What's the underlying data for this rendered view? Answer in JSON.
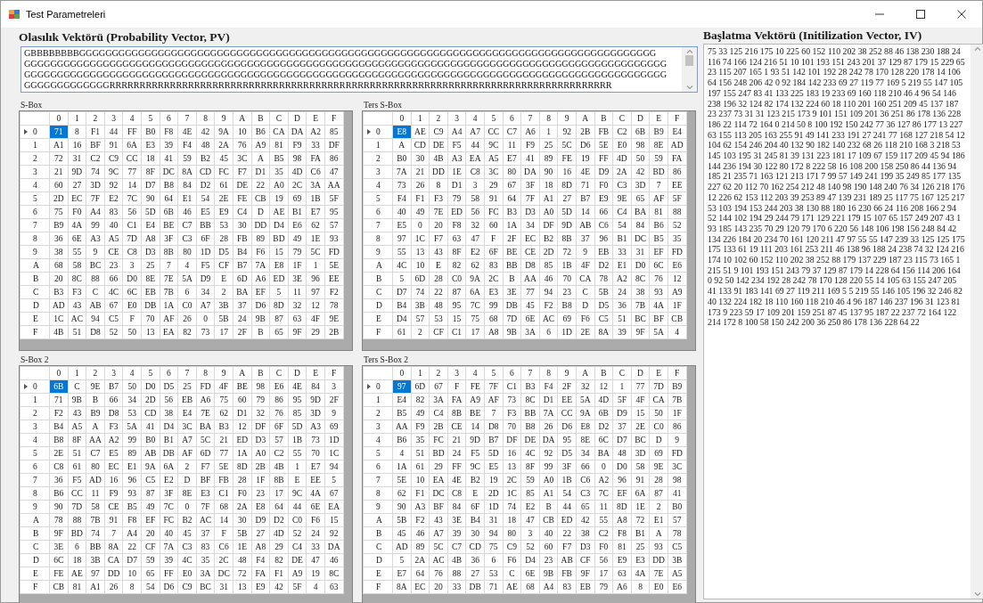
{
  "window": {
    "title": "Test Parametreleri"
  },
  "probability_vector": {
    "title": "Olasılık Vektörü (Probability Vector, PV)",
    "lines": [
      "GBBBBBBBBGGGGGGGGGGGGGGGGGGGGGGGGGGGGGGGGGGGGGGGGGGGGGGGGGGGGGGGGGGGGGGGGGGGGGGGGGGGGGGGGGGGGGGGG",
      "GGGGGGGGGGGGGGGGGGGGGGGGGGGGGGGGGGGGGGGGGGGGGGGGGGGGGGGGGGGGGGGGGGGGGGGGGGGGGGGGGGGGGGGGGGGGGGGGGG",
      "GGGGGGGGGGGGGGGGGGGGGGGGGGGGGGGGGGGGGGGGGGGGGGGGGGGGGGGGGGGGGGGGGGGGGGGGGGGGGGGGGGGGGGGGGGGGGGGGGG",
      "GGGGGGGGGGGGGRRRRRRRRRRRRRRRRRRRRRRRRRRRRRRRRRRRRRRRRRRRRRRRRRRRRRRRRRRRRRRRRRRRRRRRRRRRRRRRRRRR"
    ]
  },
  "tables": [
    {
      "title": "S-Box",
      "columns": [
        "0",
        "1",
        "2",
        "3",
        "4",
        "5",
        "6",
        "7",
        "8",
        "9",
        "A",
        "B",
        "C",
        "D",
        "E",
        "F"
      ],
      "rows": [
        {
          "header": "0",
          "selected": true,
          "cells": [
            "71",
            "8",
            "F1",
            "44",
            "FF",
            "B0",
            "F8",
            "4E",
            "42",
            "9A",
            "10",
            "B6",
            "CA",
            "DA",
            "A2",
            "85"
          ]
        },
        {
          "header": "1",
          "selected": false,
          "cells": [
            "A1",
            "16",
            "BF",
            "91",
            "6A",
            "E3",
            "39",
            "F4",
            "48",
            "2A",
            "76",
            "A9",
            "81",
            "F9",
            "33",
            "DF"
          ]
        },
        {
          "header": "2",
          "selected": false,
          "cells": [
            "72",
            "31",
            "C2",
            "C9",
            "CC",
            "18",
            "41",
            "59",
            "B2",
            "45",
            "3C",
            "A",
            "B5",
            "98",
            "FA",
            "86"
          ]
        },
        {
          "header": "3",
          "selected": false,
          "cells": [
            "21",
            "9D",
            "74",
            "9C",
            "77",
            "8F",
            "DC",
            "8A",
            "CD",
            "FC",
            "F7",
            "D1",
            "35",
            "4D",
            "C6",
            "47"
          ]
        },
        {
          "header": "4",
          "selected": false,
          "cells": [
            "60",
            "27",
            "3D",
            "92",
            "14",
            "D7",
            "B8",
            "84",
            "D2",
            "61",
            "DE",
            "22",
            "A0",
            "2C",
            "3A",
            "AA"
          ]
        },
        {
          "header": "5",
          "selected": false,
          "cells": [
            "2D",
            "EC",
            "7F",
            "E2",
            "7C",
            "90",
            "64",
            "E1",
            "54",
            "2E",
            "FE",
            "CB",
            "19",
            "69",
            "1B",
            "5F"
          ]
        },
        {
          "header": "6",
          "selected": false,
          "cells": [
            "75",
            "F0",
            "A4",
            "83",
            "56",
            "5D",
            "6B",
            "46",
            "E5",
            "E9",
            "C4",
            "D",
            "AE",
            "B1",
            "E7",
            "95"
          ]
        },
        {
          "header": "7",
          "selected": false,
          "cells": [
            "B9",
            "4A",
            "99",
            "40",
            "C1",
            "E4",
            "BE",
            "C7",
            "BB",
            "53",
            "30",
            "DD",
            "D4",
            "E6",
            "62",
            "57"
          ]
        },
        {
          "header": "8",
          "selected": false,
          "cells": [
            "36",
            "6E",
            "A3",
            "A5",
            "7D",
            "A8",
            "3F",
            "C3",
            "6F",
            "28",
            "FB",
            "89",
            "BD",
            "49",
            "1E",
            "93"
          ]
        },
        {
          "header": "9",
          "selected": false,
          "cells": [
            "38",
            "55",
            "9",
            "CE",
            "C8",
            "D3",
            "8B",
            "80",
            "1D",
            "D5",
            "B4",
            "F6",
            "15",
            "79",
            "5C",
            "FD"
          ]
        },
        {
          "header": "A",
          "selected": false,
          "cells": [
            "68",
            "58",
            "BC",
            "23",
            "3",
            "25",
            "7",
            "4",
            "F5",
            "CF",
            "B7",
            "7A",
            "E8",
            "1F",
            "1",
            "5E"
          ]
        },
        {
          "header": "B",
          "selected": false,
          "cells": [
            "20",
            "8C",
            "88",
            "66",
            "D0",
            "8E",
            "7E",
            "5A",
            "D9",
            "E",
            "6D",
            "A6",
            "ED",
            "3E",
            "96",
            "EE"
          ]
        },
        {
          "header": "C",
          "selected": false,
          "cells": [
            "B3",
            "F3",
            "C",
            "4C",
            "6C",
            "EB",
            "7B",
            "6",
            "34",
            "2",
            "BA",
            "EF",
            "5",
            "11",
            "97",
            "F2"
          ]
        },
        {
          "header": "D",
          "selected": false,
          "cells": [
            "AD",
            "43",
            "AB",
            "67",
            "E0",
            "DB",
            "1A",
            "C0",
            "A7",
            "3B",
            "37",
            "D6",
            "8D",
            "32",
            "12",
            "78"
          ]
        },
        {
          "header": "E",
          "selected": false,
          "cells": [
            "1C",
            "AC",
            "94",
            "C5",
            "F",
            "70",
            "AF",
            "26",
            "0",
            "5B",
            "24",
            "9B",
            "87",
            "63",
            "4F",
            "9E"
          ]
        },
        {
          "header": "F",
          "selected": false,
          "cells": [
            "4B",
            "51",
            "D8",
            "52",
            "50",
            "13",
            "EA",
            "82",
            "73",
            "17",
            "2F",
            "B",
            "65",
            "9F",
            "29",
            "2B"
          ]
        }
      ]
    },
    {
      "title": "Ters S-Box",
      "columns": [
        "0",
        "1",
        "2",
        "3",
        "4",
        "5",
        "6",
        "7",
        "8",
        "9",
        "A",
        "B",
        "C",
        "D",
        "E",
        "F"
      ],
      "rows": [
        {
          "header": "0",
          "selected": true,
          "cells": [
            "E8",
            "AE",
            "C9",
            "A4",
            "A7",
            "CC",
            "C7",
            "A6",
            "1",
            "92",
            "2B",
            "FB",
            "C2",
            "6B",
            "B9",
            "E4"
          ]
        },
        {
          "header": "1",
          "selected": false,
          "cells": [
            "A",
            "CD",
            "DE",
            "F5",
            "44",
            "9C",
            "11",
            "F9",
            "25",
            "5C",
            "D6",
            "5E",
            "E0",
            "98",
            "8E",
            "AD"
          ]
        },
        {
          "header": "2",
          "selected": false,
          "cells": [
            "B0",
            "30",
            "4B",
            "A3",
            "EA",
            "A5",
            "E7",
            "41",
            "89",
            "FE",
            "19",
            "FF",
            "4D",
            "50",
            "59",
            "FA"
          ]
        },
        {
          "header": "3",
          "selected": false,
          "cells": [
            "7A",
            "21",
            "DD",
            "1E",
            "C8",
            "3C",
            "80",
            "DA",
            "90",
            "16",
            "4E",
            "D9",
            "2A",
            "42",
            "BD",
            "86"
          ]
        },
        {
          "header": "4",
          "selected": false,
          "cells": [
            "73",
            "26",
            "8",
            "D1",
            "3",
            "29",
            "67",
            "3F",
            "18",
            "8D",
            "71",
            "F0",
            "C3",
            "3D",
            "7",
            "EE"
          ]
        },
        {
          "header": "5",
          "selected": false,
          "cells": [
            "F4",
            "F1",
            "F3",
            "79",
            "58",
            "91",
            "64",
            "7F",
            "A1",
            "27",
            "B7",
            "E9",
            "9E",
            "65",
            "AF",
            "5F"
          ]
        },
        {
          "header": "6",
          "selected": false,
          "cells": [
            "40",
            "49",
            "7E",
            "ED",
            "56",
            "FC",
            "B3",
            "D3",
            "A0",
            "5D",
            "14",
            "66",
            "C4",
            "BA",
            "81",
            "88"
          ]
        },
        {
          "header": "7",
          "selected": false,
          "cells": [
            "E5",
            "0",
            "20",
            "F8",
            "32",
            "60",
            "1A",
            "34",
            "DF",
            "9D",
            "AB",
            "C6",
            "54",
            "84",
            "B6",
            "52"
          ]
        },
        {
          "header": "8",
          "selected": false,
          "cells": [
            "97",
            "1C",
            "F7",
            "63",
            "47",
            "F",
            "2F",
            "EC",
            "B2",
            "8B",
            "37",
            "96",
            "B1",
            "DC",
            "B5",
            "35"
          ]
        },
        {
          "header": "9",
          "selected": false,
          "cells": [
            "55",
            "13",
            "43",
            "8F",
            "E2",
            "6F",
            "BE",
            "CE",
            "2D",
            "72",
            "9",
            "EB",
            "33",
            "31",
            "EF",
            "FD"
          ]
        },
        {
          "header": "A",
          "selected": false,
          "cells": [
            "4C",
            "10",
            "E",
            "82",
            "62",
            "83",
            "BB",
            "D8",
            "85",
            "1B",
            "4F",
            "D2",
            "E1",
            "D0",
            "6C",
            "E6"
          ]
        },
        {
          "header": "B",
          "selected": false,
          "cells": [
            "5",
            "6D",
            "28",
            "C0",
            "9A",
            "2C",
            "B",
            "AA",
            "46",
            "70",
            "CA",
            "78",
            "A2",
            "8C",
            "76",
            "12"
          ]
        },
        {
          "header": "C",
          "selected": false,
          "cells": [
            "D7",
            "74",
            "22",
            "87",
            "6A",
            "E3",
            "3E",
            "77",
            "94",
            "23",
            "C",
            "5B",
            "24",
            "38",
            "93",
            "A9"
          ]
        },
        {
          "header": "D",
          "selected": false,
          "cells": [
            "B4",
            "3B",
            "48",
            "95",
            "7C",
            "99",
            "DB",
            "45",
            "F2",
            "B8",
            "D",
            "D5",
            "36",
            "7B",
            "4A",
            "1F"
          ]
        },
        {
          "header": "E",
          "selected": false,
          "cells": [
            "D4",
            "57",
            "53",
            "15",
            "75",
            "68",
            "7D",
            "6E",
            "AC",
            "69",
            "F6",
            "C5",
            "51",
            "BC",
            "BF",
            "CB"
          ]
        },
        {
          "header": "F",
          "selected": false,
          "cells": [
            "61",
            "2",
            "CF",
            "C1",
            "17",
            "A8",
            "9B",
            "3A",
            "6",
            "1D",
            "2E",
            "8A",
            "39",
            "9F",
            "5A",
            "4"
          ]
        }
      ]
    },
    {
      "title": "S-Box 2",
      "columns": [
        "0",
        "1",
        "2",
        "3",
        "4",
        "5",
        "6",
        "7",
        "8",
        "9",
        "A",
        "B",
        "C",
        "D",
        "E",
        "F"
      ],
      "rows": [
        {
          "header": "0",
          "selected": true,
          "cells": [
            "6B",
            "C",
            "9E",
            "B7",
            "50",
            "D0",
            "D5",
            "25",
            "FD",
            "4F",
            "BE",
            "98",
            "E6",
            "4E",
            "84",
            "3"
          ]
        },
        {
          "header": "1",
          "selected": false,
          "cells": [
            "71",
            "9B",
            "B",
            "66",
            "34",
            "2D",
            "56",
            "EB",
            "A6",
            "75",
            "60",
            "79",
            "86",
            "95",
            "9D",
            "2F"
          ]
        },
        {
          "header": "2",
          "selected": false,
          "cells": [
            "F2",
            "43",
            "B9",
            "D8",
            "53",
            "CD",
            "38",
            "E4",
            "7E",
            "62",
            "D1",
            "32",
            "76",
            "85",
            "3D",
            "9"
          ]
        },
        {
          "header": "3",
          "selected": false,
          "cells": [
            "B4",
            "A5",
            "A",
            "F3",
            "5A",
            "41",
            "D4",
            "3C",
            "BA",
            "B3",
            "12",
            "DF",
            "6F",
            "5D",
            "A3",
            "69"
          ]
        },
        {
          "header": "4",
          "selected": false,
          "cells": [
            "B8",
            "8F",
            "AA",
            "A2",
            "99",
            "B0",
            "B1",
            "A7",
            "5C",
            "21",
            "ED",
            "D3",
            "57",
            "1B",
            "73",
            "1D"
          ]
        },
        {
          "header": "5",
          "selected": false,
          "cells": [
            "2E",
            "51",
            "C7",
            "E5",
            "89",
            "AB",
            "DB",
            "AF",
            "6D",
            "77",
            "1A",
            "A0",
            "C2",
            "55",
            "70",
            "1C"
          ]
        },
        {
          "header": "6",
          "selected": false,
          "cells": [
            "C8",
            "61",
            "80",
            "EC",
            "E1",
            "9A",
            "6A",
            "2",
            "F7",
            "5E",
            "8D",
            "2B",
            "4B",
            "1",
            "E7",
            "94"
          ]
        },
        {
          "header": "7",
          "selected": false,
          "cells": [
            "36",
            "F5",
            "AD",
            "16",
            "96",
            "C5",
            "E2",
            "D",
            "BF",
            "FB",
            "28",
            "1F",
            "8B",
            "E",
            "EE",
            "5"
          ]
        },
        {
          "header": "8",
          "selected": false,
          "cells": [
            "B6",
            "CC",
            "11",
            "F9",
            "93",
            "87",
            "3F",
            "8E",
            "E3",
            "C1",
            "F0",
            "23",
            "17",
            "9C",
            "4A",
            "67"
          ]
        },
        {
          "header": "9",
          "selected": false,
          "cells": [
            "90",
            "7D",
            "58",
            "CE",
            "B5",
            "49",
            "7C",
            "0",
            "7F",
            "68",
            "2A",
            "E8",
            "64",
            "44",
            "6E",
            "EA"
          ]
        },
        {
          "header": "A",
          "selected": false,
          "cells": [
            "78",
            "88",
            "7B",
            "91",
            "F8",
            "EF",
            "FC",
            "B2",
            "AC",
            "14",
            "30",
            "D9",
            "D2",
            "C0",
            "F6",
            "15"
          ]
        },
        {
          "header": "B",
          "selected": false,
          "cells": [
            "9F",
            "BD",
            "74",
            "7",
            "A4",
            "20",
            "40",
            "45",
            "37",
            "F",
            "5B",
            "27",
            "4D",
            "52",
            "24",
            "92"
          ]
        },
        {
          "header": "C",
          "selected": false,
          "cells": [
            "3E",
            "6",
            "BB",
            "8A",
            "22",
            "CF",
            "7A",
            "C3",
            "83",
            "C6",
            "1E",
            "A8",
            "29",
            "C4",
            "33",
            "DA"
          ]
        },
        {
          "header": "D",
          "selected": false,
          "cells": [
            "6C",
            "18",
            "3B",
            "CA",
            "D7",
            "59",
            "39",
            "4C",
            "35",
            "2C",
            "48",
            "F4",
            "82",
            "DE",
            "47",
            "46"
          ]
        },
        {
          "header": "E",
          "selected": false,
          "cells": [
            "FE",
            "AE",
            "97",
            "DD",
            "10",
            "65",
            "FF",
            "E0",
            "3A",
            "DC",
            "72",
            "FA",
            "F1",
            "A9",
            "19",
            "8C"
          ]
        },
        {
          "header": "F",
          "selected": false,
          "cells": [
            "CB",
            "81",
            "A1",
            "26",
            "8",
            "54",
            "D6",
            "C9",
            "BC",
            "31",
            "13",
            "E9",
            "42",
            "5F",
            "4",
            "63"
          ]
        }
      ]
    },
    {
      "title": "Ters S-Box 2",
      "columns": [
        "0",
        "1",
        "2",
        "3",
        "4",
        "5",
        "6",
        "7",
        "8",
        "9",
        "A",
        "B",
        "C",
        "D",
        "E",
        "F"
      ],
      "rows": [
        {
          "header": "0",
          "selected": true,
          "cells": [
            "97",
            "6D",
            "67",
            "F",
            "FE",
            "7F",
            "C1",
            "B3",
            "F4",
            "2F",
            "32",
            "12",
            "1",
            "77",
            "7D",
            "B9"
          ]
        },
        {
          "header": "1",
          "selected": false,
          "cells": [
            "E4",
            "82",
            "3A",
            "FA",
            "A9",
            "AF",
            "73",
            "8C",
            "D1",
            "EE",
            "5A",
            "4D",
            "5F",
            "4F",
            "CA",
            "7B"
          ]
        },
        {
          "header": "2",
          "selected": false,
          "cells": [
            "B5",
            "49",
            "C4",
            "8B",
            "BE",
            "7",
            "F3",
            "BB",
            "7A",
            "CC",
            "9A",
            "6B",
            "D9",
            "15",
            "50",
            "1F"
          ]
        },
        {
          "header": "3",
          "selected": false,
          "cells": [
            "AA",
            "F9",
            "2B",
            "CE",
            "14",
            "D8",
            "70",
            "B8",
            "26",
            "D6",
            "E8",
            "D2",
            "37",
            "2E",
            "C0",
            "86"
          ]
        },
        {
          "header": "4",
          "selected": false,
          "cells": [
            "B6",
            "35",
            "FC",
            "21",
            "9D",
            "B7",
            "DF",
            "DE",
            "DA",
            "95",
            "8E",
            "6C",
            "D7",
            "BC",
            "D",
            "9"
          ]
        },
        {
          "header": "5",
          "selected": false,
          "cells": [
            "4",
            "51",
            "BD",
            "24",
            "F5",
            "5D",
            "16",
            "4C",
            "92",
            "D5",
            "34",
            "BA",
            "48",
            "3D",
            "69",
            "FD"
          ]
        },
        {
          "header": "6",
          "selected": false,
          "cells": [
            "1A",
            "61",
            "29",
            "FF",
            "9C",
            "E5",
            "13",
            "8F",
            "99",
            "3F",
            "66",
            "0",
            "D0",
            "58",
            "9E",
            "3C"
          ]
        },
        {
          "header": "7",
          "selected": false,
          "cells": [
            "5E",
            "10",
            "EA",
            "4E",
            "B2",
            "19",
            "2C",
            "59",
            "A0",
            "1B",
            "C6",
            "A2",
            "96",
            "91",
            "28",
            "98"
          ]
        },
        {
          "header": "8",
          "selected": false,
          "cells": [
            "62",
            "F1",
            "DC",
            "C8",
            "E",
            "2D",
            "1C",
            "85",
            "A1",
            "54",
            "C3",
            "7C",
            "EF",
            "6A",
            "87",
            "41"
          ]
        },
        {
          "header": "9",
          "selected": false,
          "cells": [
            "90",
            "A3",
            "BF",
            "84",
            "6F",
            "1D",
            "74",
            "E2",
            "B",
            "44",
            "65",
            "11",
            "8D",
            "1E",
            "2",
            "B0"
          ]
        },
        {
          "header": "A",
          "selected": false,
          "cells": [
            "5B",
            "F2",
            "43",
            "3E",
            "B4",
            "31",
            "18",
            "47",
            "CB",
            "ED",
            "42",
            "55",
            "A8",
            "72",
            "E1",
            "57"
          ]
        },
        {
          "header": "B",
          "selected": false,
          "cells": [
            "45",
            "46",
            "A7",
            "39",
            "30",
            "94",
            "80",
            "3",
            "40",
            "22",
            "38",
            "C2",
            "F8",
            "B1",
            "A",
            "78"
          ]
        },
        {
          "header": "C",
          "selected": false,
          "cells": [
            "AD",
            "89",
            "5C",
            "C7",
            "CD",
            "75",
            "C9",
            "52",
            "60",
            "F7",
            "D3",
            "F0",
            "81",
            "25",
            "93",
            "C5"
          ]
        },
        {
          "header": "D",
          "selected": false,
          "cells": [
            "5",
            "2A",
            "AC",
            "4B",
            "36",
            "6",
            "F6",
            "D4",
            "23",
            "AB",
            "CF",
            "56",
            "E9",
            "E3",
            "DD",
            "3B"
          ]
        },
        {
          "header": "E",
          "selected": false,
          "cells": [
            "E7",
            "64",
            "76",
            "88",
            "27",
            "53",
            "C",
            "6E",
            "9B",
            "FB",
            "9F",
            "17",
            "63",
            "4A",
            "7E",
            "A5"
          ]
        },
        {
          "header": "F",
          "selected": false,
          "cells": [
            "8A",
            "EC",
            "20",
            "33",
            "DB",
            "71",
            "AE",
            "68",
            "A4",
            "83",
            "EB",
            "79",
            "A6",
            "8",
            "E0",
            "E6"
          ]
        }
      ]
    }
  ],
  "initialization_vector": {
    "title": "Başlatma Vektörü (Initilization Vector, IV)",
    "lines": [
      "75 33 125 216 175 10 225 60 152 110 202 38 252 88 46 138 230 188 24",
      "116 74 166 124 216 51 10 101 193 151 243 201 37 129 87 179 15 229 65",
      "23 115 207 165 1 93 51 142 101 192 28 242 78 170 128 220 178 14 106",
      "64 156 248 206 42 0 92 184 142 233 69 27 119 77 169 5 219 55 147 105",
      "197 155 247 83 41 133 225 183 19 233 69 160 118 210 46 4 96 54 146",
      "238 196 32 124 82 174 132 224 60 18 110 201 160 251 209 45 137 187",
      "23 237 73 31 31 123 215 173 9 101 151 109 201 36 251 86 178 136 228",
      "186 22 114 72 164 0 214 50 8 100 192 150 242 77 36 127 86 177 13 227",
      "63 155 113 205 163 255 91 49 141 233 191 27 241 77 168 127 218 54 12",
      "104 62 154 246 204 40 132 90 182 140 232 68 26 118 210 168 3 218 53",
      "145 103 195 31 245 81 39 131 223 181 17 109 67 159 117 209 45 94 186",
      "144 236 194 30 122 80 172 8 222 58 16 108 200 158 250 86 44 136 94",
      "185 21 235 71 163 121 213 171 7 99 57 149 241 199 35 249 85 177 135",
      "227 62 20 112 70 162 254 212 48 140 98 190 148 240 76 34 126 218 176",
      "12 226 62 153 112 203 39 253 89 47 139 231 189 25 117 75 167 125 217",
      "53 103 194 153 244 203 38 130 88 180 16 230 66 24 116 208 166 2 94",
      "52 144 102 194 29 244 79 171 129 221 179 15 107 65 157 249 207 43 1",
      "93 185 143 235 70 29 120 79 170 6 220 56 148 106 198 156 248 84 42",
      "134 226 184 20 234 70 161 120 211 47 97 55 55 147 239 33 125 125 175",
      "175 133 61 19 111 203 161 253 211 46 138 96 188 24 238 74 32 124 216",
      "174 10 102 60 152 110 202 38 252 88 179 137 229 187 23 115 73 165 1",
      "215 51 9 101 193 151 243 79 37 129 87 179 14 228 64 156 114 206 164",
      "0 92 50 142 234 192 28 242 78 170 128 220 55 14 105 63 155 247 205",
      "41 133 91 183 141 69 27 119 211 169 5 5 219 55 146 105 196 32 246 82",
      "40 132 224 182 18 110 160 118 210 46 4 96 187 146 237 196 31 123 81",
      "173 9 223 59 17 109 201 159 251 87 45 137 95 187 22 237 72 164 122",
      "214 172 8 100 58 150 242 200 36 250 86 178 136 228 64 22"
    ]
  }
}
